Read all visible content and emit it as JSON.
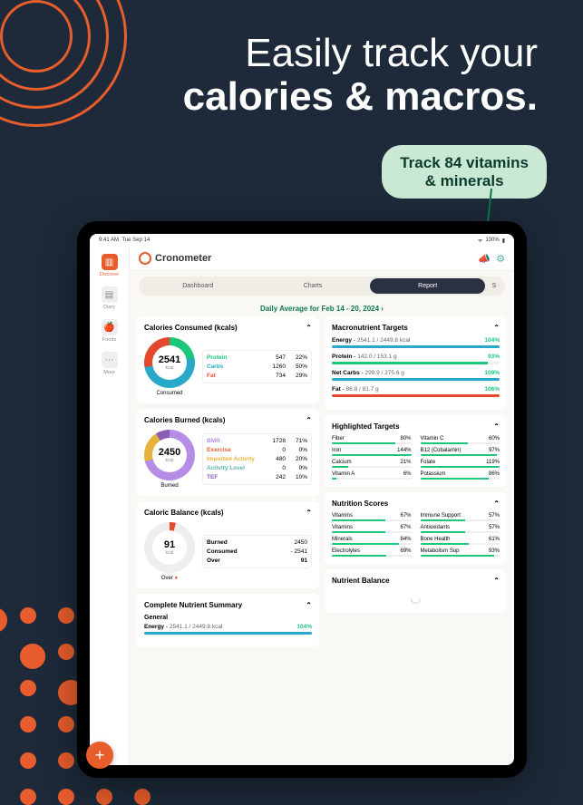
{
  "promo": {
    "headline_line1": "Easily track your",
    "headline_line2": "calories & macros.",
    "callout_line1": "Track 84 vitamins",
    "callout_line2": "& minerals"
  },
  "statusbar": {
    "time": "9:41 AM",
    "date": "Tue Sep 14",
    "battery": "100%"
  },
  "brand": "Cronometer",
  "sidebar": {
    "items": [
      {
        "label": "Discover"
      },
      {
        "label": "Diary"
      },
      {
        "label": "Foods"
      },
      {
        "label": "More"
      }
    ]
  },
  "tabs": [
    {
      "label": "Dashboard"
    },
    {
      "label": "Charts"
    },
    {
      "label": "Report"
    },
    {
      "label": "S"
    }
  ],
  "daterange": "Daily Average for Feb 14 - 20, 2024  ›",
  "caloriesConsumed": {
    "title": "Calories Consumed (kcals)",
    "value": "2541",
    "unit": "kcal",
    "label": "Consumed",
    "rows": [
      {
        "name": "Protein",
        "color": "#1cc77a",
        "v": "547",
        "pct": "22%"
      },
      {
        "name": "Carbs",
        "color": "#2aa8c9",
        "v": "1260",
        "pct": "50%"
      },
      {
        "name": "Fat",
        "color": "#e4482d",
        "v": "734",
        "pct": "29%"
      }
    ]
  },
  "caloriesBurned": {
    "title": "Calories Burned (kcals)",
    "value": "2450",
    "unit": "kcal",
    "label": "Burned",
    "rows": [
      {
        "name": "BMR",
        "color": "#b58de6",
        "v": "1728",
        "pct": "71%"
      },
      {
        "name": "Exercise",
        "color": "#e85d2c",
        "v": "0",
        "pct": "0%"
      },
      {
        "name": "Imported Activity",
        "color": "#e6b23d",
        "v": "480",
        "pct": "20%"
      },
      {
        "name": "Activity Level",
        "color": "#5bb5a8",
        "v": "0",
        "pct": "0%"
      },
      {
        "name": "TEF",
        "color": "#8a5db5",
        "v": "242",
        "pct": "10%"
      }
    ]
  },
  "caloricBalance": {
    "title": "Caloric Balance (kcals)",
    "value": "91",
    "unit": "kcal",
    "label": "Over",
    "rows": [
      {
        "name": "Burned",
        "v": "2450"
      },
      {
        "name": "Consumed",
        "v": "- 2541"
      },
      {
        "name": "Over",
        "v": "91",
        "bold": true
      }
    ]
  },
  "nutrientSummary": {
    "title": "Complete Nutrient Summary",
    "section": "General",
    "energy": {
      "name": "Energy",
      "detail": "2541.1 / 2449.8 kcal",
      "pct": "104%"
    }
  },
  "macroTargets": {
    "title": "Macronutrient Targets",
    "rows": [
      {
        "name": "Energy",
        "detail": "2541.1 / 2449.8 kcal",
        "pct": "104%",
        "color": "#2aa8c9"
      },
      {
        "name": "Protein",
        "detail": "142.0 / 153.1 g",
        "pct": "93%",
        "color": "#1cc77a"
      },
      {
        "name": "Net Carbs",
        "detail": "299.9 / 275.6 g",
        "pct": "109%",
        "color": "#2aa8c9"
      },
      {
        "name": "Fat",
        "detail": "86.8 / 81.7 g",
        "pct": "106%",
        "color": "#e4482d"
      }
    ]
  },
  "highlighted": {
    "title": "Highlighted Targets",
    "items": [
      {
        "name": "Fiber",
        "pct": "80%"
      },
      {
        "name": "Vitamin C",
        "pct": "60%"
      },
      {
        "name": "Iron",
        "pct": "144%"
      },
      {
        "name": "B12 (Cobalamin)",
        "pct": "97%"
      },
      {
        "name": "Calcium",
        "pct": "21%"
      },
      {
        "name": "Folate",
        "pct": "119%"
      },
      {
        "name": "Vitamin A",
        "pct": "6%"
      },
      {
        "name": "Potassium",
        "pct": "86%"
      }
    ]
  },
  "scores": {
    "title": "Nutrition Scores",
    "items": [
      {
        "name": "Vitamins",
        "pct": "67%"
      },
      {
        "name": "Immune Support",
        "pct": "57%"
      },
      {
        "name": "Vitamins",
        "pct": "67%"
      },
      {
        "name": "Antioxidants",
        "pct": "57%"
      },
      {
        "name": "Minerals",
        "pct": "84%"
      },
      {
        "name": "Bone Health",
        "pct": "61%"
      },
      {
        "name": "Electrolytes",
        "pct": "69%"
      },
      {
        "name": "Metabolism Sup",
        "pct": "93%"
      }
    ]
  },
  "nutrientBalance": {
    "title": "Nutrient Balance"
  },
  "colors": {
    "accent": "#e85d2c",
    "green": "#1cc77a",
    "teal": "#2aa8c9",
    "red": "#e4482d"
  }
}
